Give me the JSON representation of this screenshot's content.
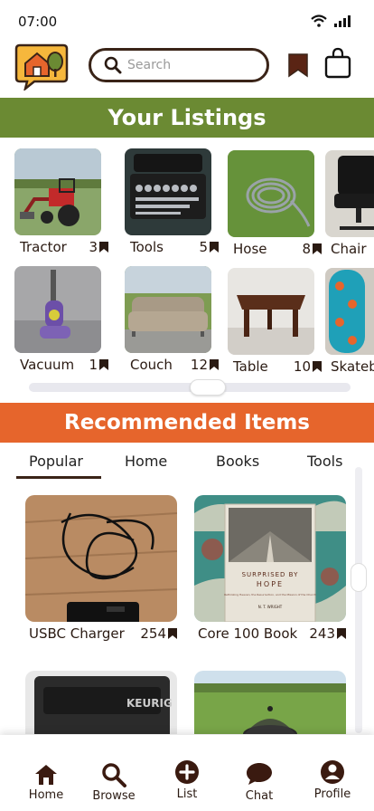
{
  "status_bar": {
    "time": "07:00"
  },
  "header": {
    "search_placeholder": "Search"
  },
  "listings_section": {
    "title": "Your Listings",
    "items": [
      {
        "name": "Tractor",
        "count": "3"
      },
      {
        "name": "Tools",
        "count": "5"
      },
      {
        "name": "Hose",
        "count": "8"
      },
      {
        "name": "Chair",
        "count": ""
      },
      {
        "name": "Vacuum",
        "count": "1"
      },
      {
        "name": "Couch",
        "count": "12"
      },
      {
        "name": "Table",
        "count": "10"
      },
      {
        "name": "Skateb",
        "count": ""
      }
    ]
  },
  "recommended_section": {
    "title": "Recommended Items",
    "tabs": [
      "Popular",
      "Home",
      "Books",
      "Tools"
    ],
    "items": [
      {
        "name": "USBC Charger",
        "count": "254"
      },
      {
        "name": "Core 100 Book",
        "count": "243"
      },
      {
        "name": "",
        "count": ""
      },
      {
        "name": "",
        "count": ""
      }
    ],
    "book_cover": {
      "title_line1": "SURPRISED BY",
      "title_line2": "HOPE",
      "subtitle": "Rethinking Heaven, the Resurrection, and the Mission of the Church",
      "author": "N. T. WRIGHT"
    },
    "appliance_brand": "KEURIG"
  },
  "bottom_nav": {
    "items": [
      {
        "label": "Home"
      },
      {
        "label": "Browse"
      },
      {
        "label": "List"
      },
      {
        "label": "Chat"
      },
      {
        "label": "Profile"
      }
    ]
  },
  "colors": {
    "brand_green": "#6b8a33",
    "brand_orange": "#e6652c",
    "dark_brown": "#3a2418",
    "logo_yellow": "#f6b73c"
  }
}
